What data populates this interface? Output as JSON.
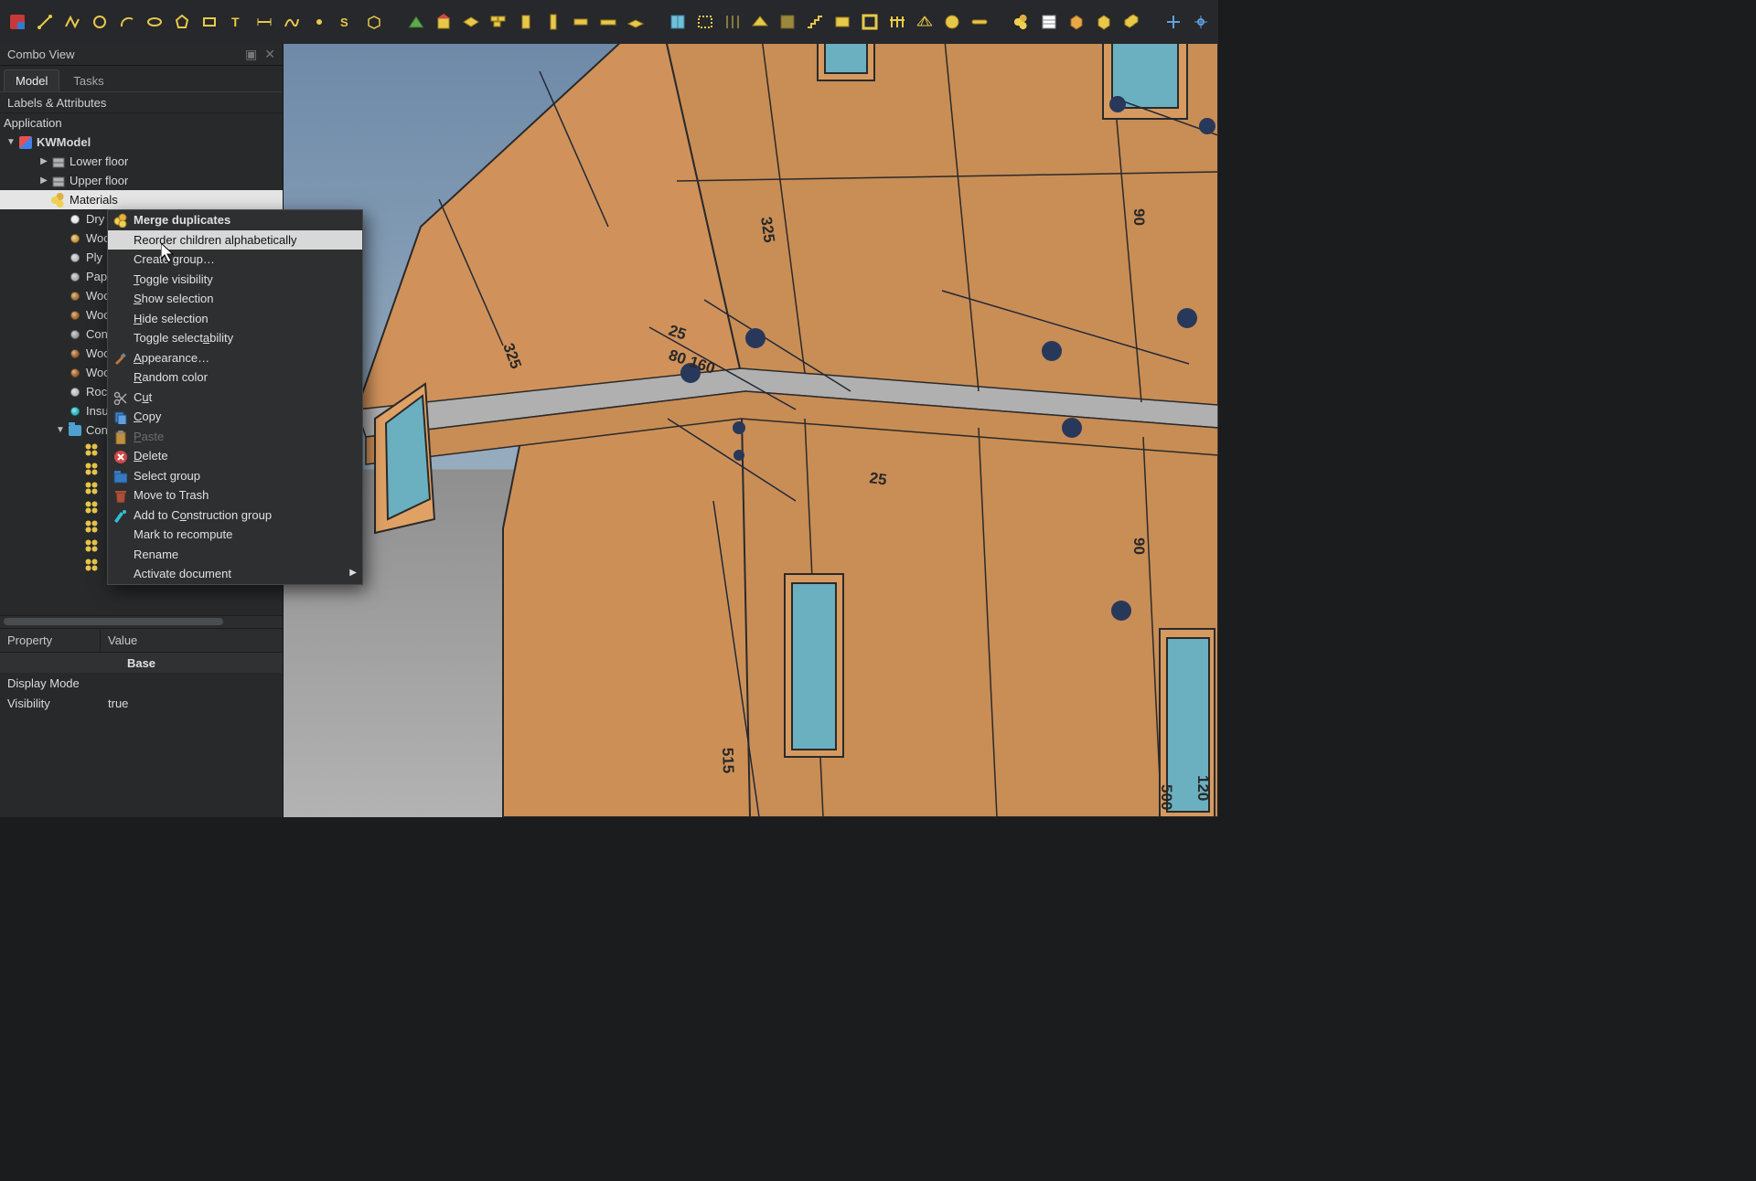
{
  "panel": {
    "title": "Combo View"
  },
  "tabs": {
    "model": "Model",
    "tasks": "Tasks"
  },
  "tree_header": "Labels & Attributes",
  "tree": {
    "root": "Application",
    "doc": "KWModel",
    "items": [
      {
        "label": "Lower floor",
        "icon": "cube",
        "indent": 2,
        "expand": "▶"
      },
      {
        "label": "Upper floor",
        "icon": "cube",
        "indent": 2,
        "expand": "▶"
      },
      {
        "label": "Materials",
        "icon": "materials",
        "indent": 2,
        "sel": true
      },
      {
        "label": "Dry",
        "icon": "dot",
        "color": "#e8e8e8",
        "indent": 3
      },
      {
        "label": "Woo",
        "icon": "dot",
        "color": "#d0a040",
        "indent": 3
      },
      {
        "label": "Ply",
        "icon": "dot",
        "color": "#c0c0c0",
        "indent": 3
      },
      {
        "label": "Pap",
        "icon": "dot",
        "color": "#b0b0b0",
        "indent": 3
      },
      {
        "label": "Woo",
        "icon": "dot",
        "color": "#b07838",
        "indent": 3
      },
      {
        "label": "Woo",
        "icon": "dot",
        "color": "#b07030",
        "indent": 3
      },
      {
        "label": "Con",
        "icon": "dot",
        "color": "#a0a0a0",
        "indent": 3
      },
      {
        "label": "Woo",
        "icon": "dot",
        "color": "#a86830",
        "indent": 3
      },
      {
        "label": "Woo",
        "icon": "dot",
        "color": "#a86830",
        "indent": 3
      },
      {
        "label": "Roc",
        "icon": "dot",
        "color": "#c0c0c0",
        "indent": 3
      },
      {
        "label": "Insu",
        "icon": "dot",
        "color": "#30c0c8",
        "indent": 3
      },
      {
        "label": "Con",
        "icon": "folder",
        "indent": 3,
        "expand": "▼"
      }
    ],
    "multimat_rows": 7
  },
  "context_menu": [
    {
      "label_html": "Merge duplicates",
      "bold": true,
      "icon": "materials"
    },
    {
      "label_html": "Reorder children alphabetically",
      "hov": true
    },
    {
      "label_html": "Create <u>g</u>roup…"
    },
    {
      "label_html": "<u>T</u>oggle visibility"
    },
    {
      "label_html": "<u>S</u>how selection"
    },
    {
      "label_html": "<u>H</u>ide selection"
    },
    {
      "label_html": "Toggle select<u>a</u>bility"
    },
    {
      "label_html": "<u>A</u>ppearance…",
      "icon": "brush"
    },
    {
      "label_html": "<u>R</u>andom color"
    },
    {
      "label_html": "C<u>u</u>t",
      "icon": "scissors"
    },
    {
      "label_html": "<u>C</u>opy",
      "icon": "copy"
    },
    {
      "label_html": "<u>P</u>aste",
      "icon": "paste",
      "dis": true
    },
    {
      "label_html": "<u>D</u>elete",
      "icon": "delete"
    },
    {
      "label_html": "Select group",
      "icon": "selectgroup"
    },
    {
      "label_html": "Move to Trash",
      "icon": "trash"
    },
    {
      "label_html": "Add to C<u>o</u>nstruction group",
      "icon": "construct"
    },
    {
      "label_html": "Mark to recompute"
    },
    {
      "label_html": "Rename"
    },
    {
      "label_html": "Activate document",
      "submenu": true
    }
  ],
  "props": {
    "hdr_a": "Property",
    "hdr_b": "Value",
    "section": "Base",
    "rows": [
      {
        "a": "Display Mode",
        "b": ""
      },
      {
        "a": "Visibility",
        "b": "true"
      }
    ]
  },
  "viewport_dims": [
    "325",
    "25",
    "80 160",
    "325",
    "90",
    "90",
    "25",
    "515",
    "120",
    "500"
  ],
  "toolbar_icon_count_row1": 28,
  "toolbar_icon_count_row2": 30
}
